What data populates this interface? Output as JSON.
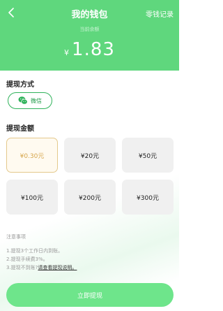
{
  "header": {
    "title": "我的钱包",
    "records_label": "零钱记录",
    "balance_label": "当前余额",
    "currency_symbol": "¥",
    "balance": "1.83"
  },
  "method": {
    "section_title": "提现方式",
    "option_label": "微信",
    "icon": "wechat-icon"
  },
  "amounts": {
    "section_title": "提现金额",
    "options": [
      "¥0.30元",
      "¥20元",
      "¥50元",
      "¥100元",
      "¥200元",
      "¥300元"
    ],
    "selected_index": 0
  },
  "notes": {
    "title": "注意事项",
    "items": [
      "1.提现3个工作日内到账。",
      "2.提现手续费3%。",
      "3.提现不到账?"
    ],
    "link": "请查看提现说明。"
  },
  "submit": {
    "label": "立即提现"
  },
  "colors": {
    "header_green": "#5fd77d",
    "button_green": "#6ee58b",
    "selected_border": "#e4c98c",
    "selected_text": "#d6a64b",
    "wechat_green": "#2fb25a"
  }
}
